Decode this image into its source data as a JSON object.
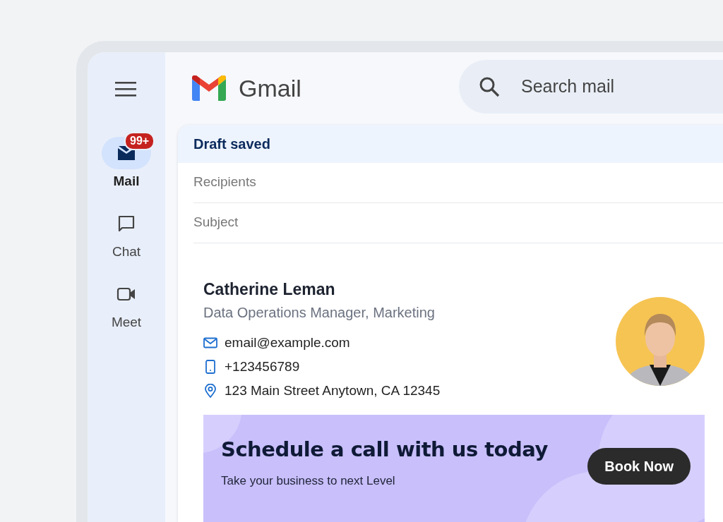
{
  "app": {
    "name": "Gmail"
  },
  "search": {
    "placeholder": "Search mail"
  },
  "nav": [
    {
      "label": "Mail",
      "kind": "mail",
      "selected": true,
      "badge": "99+"
    },
    {
      "label": "Chat",
      "kind": "chat",
      "selected": false
    },
    {
      "label": "Meet",
      "kind": "video",
      "selected": false
    }
  ],
  "compose": {
    "title": "Draft saved",
    "fields": [
      {
        "placeholder": "Recipients"
      },
      {
        "placeholder": "Subject"
      }
    ],
    "signature": {
      "name": "Catherine Leman",
      "title": "Data Operations Manager, Marketing",
      "contacts": [
        {
          "kind": "email",
          "text": "email@example.com"
        },
        {
          "kind": "phone",
          "text": "+123456789"
        },
        {
          "kind": "location",
          "text": "123 Main Street Anytown, CA 12345"
        }
      ],
      "banner": {
        "headline": "Schedule a call with us today",
        "subline": "Take your business to next Level",
        "button": "Book Now"
      }
    }
  }
}
